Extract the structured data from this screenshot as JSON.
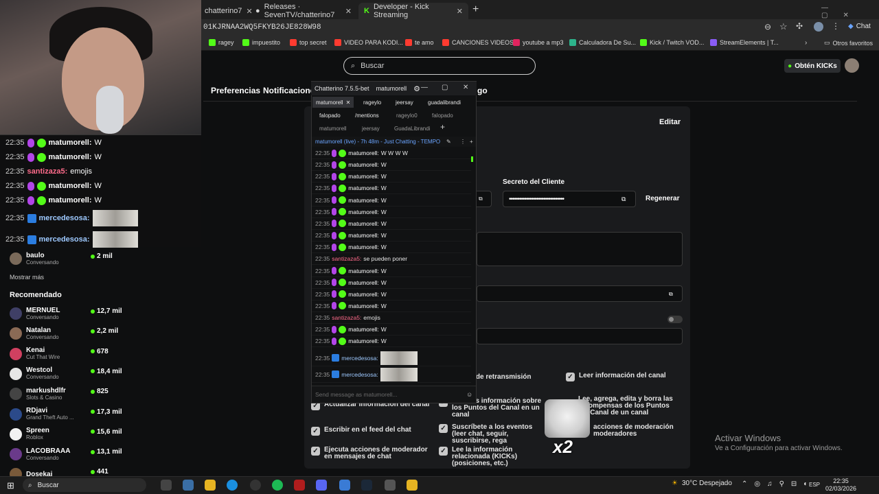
{
  "browser": {
    "tabs": [
      {
        "label": "chatterino7",
        "icon": "tab-icon"
      },
      {
        "label": "Releases · SevenTV/chatterino7",
        "icon": "github-icon"
      },
      {
        "label": "Developer - Kick Streaming",
        "icon": "kick-icon"
      }
    ],
    "url": "01KJRNAA2WQ5FKYB26JE828W98",
    "chat_label": "Chat",
    "bookmarks": [
      {
        "label": "ragey",
        "color": "#53fc18"
      },
      {
        "label": "impuestito",
        "color": "#53fc18"
      },
      {
        "label": "top secret",
        "color": "#ff3b30"
      },
      {
        "label": "VIDEO PARA KODI...",
        "color": "#ff3b30"
      },
      {
        "label": "te amo",
        "color": "#ff3b30"
      },
      {
        "label": "CANCIONES VIDEOS",
        "color": "#ff3b30"
      },
      {
        "label": "youtube a mp3",
        "color": "#e0245e"
      },
      {
        "label": "Calculadora De Su...",
        "color": "#2db38b"
      },
      {
        "label": "Kick / Twitch VOD...",
        "color": "#53fc18"
      },
      {
        "label": "StreamElements | T...",
        "color": "#8a5cf6"
      }
    ],
    "other_bookmarks": "Otros favoritos"
  },
  "kick": {
    "search_placeholder": "Buscar",
    "kicks_button": "Obtén KICKs",
    "nav": [
      "Preferencias",
      "Notificaciones",
      "go"
    ],
    "edit_button": "Editar",
    "client_secret_label": "Secreto del Cliente",
    "client_secret_value": "••••••••••••••••••••••••••••••••",
    "regenerate_button": "Regenerar",
    "permissions": [
      {
        "label": "ve de retransmisión",
        "checked": false
      },
      {
        "label": "Leer información del canal",
        "checked": true
      },
      {
        "label": "Lee más información sobre los Puntos del Canal en un canal",
        "checked": false
      },
      {
        "label": "Lee, agrega, edita y borra las recompensas de los Puntos del Canal de un canal",
        "checked": false
      },
      {
        "label": "Actualizar información del canal",
        "checked": true
      },
      {
        "label": "Escribir en el feed del chat",
        "checked": true
      },
      {
        "label": "Suscríbete a los eventos (leer chat, seguir, suscribirse, rega",
        "checked": true
      },
      {
        "label": "acciones de moderación moderadores",
        "checked": false
      },
      {
        "label": "Ejecuta acciones de moderador en mensajes de chat",
        "checked": true
      },
      {
        "label": "Lee la información relacionada (KICKs) (posiciones, etc.)",
        "checked": true
      }
    ],
    "sidebar_channels_top": [
      {
        "name": "baulo",
        "sub": "Conversando",
        "viewers": "2 mil",
        "color": "#7a6a5a"
      }
    ],
    "show_more": "Mostrar más",
    "recommended_title": "Recomendado",
    "recommended": [
      {
        "name": "MERNUEL",
        "sub": "Conversando",
        "viewers": "12,7 mil",
        "color": "#3f3f66"
      },
      {
        "name": "Natalan",
        "sub": "Conversando",
        "viewers": "2,2 mil",
        "color": "#8a6a55"
      },
      {
        "name": "Kenai",
        "sub": "Cut That Wire",
        "viewers": "678",
        "color": "#d04060"
      },
      {
        "name": "Westcol",
        "sub": "Conversando",
        "viewers": "18,4 mil",
        "color": "#e6e6e6"
      },
      {
        "name": "markushdlfr",
        "sub": "Slots & Casino",
        "viewers": "825",
        "color": "#444444"
      },
      {
        "name": "RDjavi",
        "sub": "Grand Theft Auto ...",
        "viewers": "17,3 mil",
        "color": "#2b4a8a"
      },
      {
        "name": "Spreen",
        "sub": "Roblox",
        "viewers": "15,6 mil",
        "color": "#f2f2f2"
      },
      {
        "name": "LACOBRAAA",
        "sub": "Conversando",
        "viewers": "13,1 mil",
        "color": "#6a3a8a"
      },
      {
        "name": "Dosekai",
        "sub": "",
        "viewers": "441",
        "color": "#7a5a3a"
      }
    ]
  },
  "overlay_chat": [
    {
      "time": "22:35",
      "user": "matumorell",
      "msg": "W",
      "type": "sub"
    },
    {
      "time": "22:35",
      "user": "matumorell",
      "msg": "W",
      "type": "sub"
    },
    {
      "time": "22:35",
      "user": "santizaza5",
      "msg": "emojis",
      "type": "plain"
    },
    {
      "time": "22:35",
      "user": "matumorell",
      "msg": "W",
      "type": "sub"
    },
    {
      "time": "22:35",
      "user": "matumorell",
      "msg": "W",
      "type": "sub"
    },
    {
      "time": "22:35",
      "user": "mercedesosa",
      "msg": "",
      "type": "emote"
    },
    {
      "time": "22:35",
      "user": "mercedesosa",
      "msg": "",
      "type": "emote"
    }
  ],
  "chatterino": {
    "title": "Chatterino 7.5.5-bet",
    "channel": "matumorell",
    "tabs_row1": [
      "matumorell",
      "rageylo",
      "jeersay",
      "guadalibrandi"
    ],
    "tabs_row2": [
      "falopado",
      "/mentions",
      "rageylo0",
      "falopado"
    ],
    "tabs_row3": [
      "matumorell",
      "jeersay",
      "GuadaLibrandi"
    ],
    "live_status": "matumorell (live) - 7h 48m - Just Chatting - TEMPO",
    "input_placeholder": "Send message as matumorell...",
    "messages": [
      {
        "time": "22:35",
        "user": "matumorell",
        "msg": "W W W W",
        "type": "sub"
      },
      {
        "time": "22:35",
        "user": "matumorell",
        "msg": "W",
        "type": "sub"
      },
      {
        "time": "22:35",
        "user": "matumorell",
        "msg": "W",
        "type": "sub"
      },
      {
        "time": "22:35",
        "user": "matumorell",
        "msg": "W",
        "type": "sub"
      },
      {
        "time": "22:35",
        "user": "matumorell",
        "msg": "W",
        "type": "sub"
      },
      {
        "time": "22:35",
        "user": "matumorell",
        "msg": "W",
        "type": "sub"
      },
      {
        "time": "22:35",
        "user": "matumorell",
        "msg": "W",
        "type": "sub"
      },
      {
        "time": "22:35",
        "user": "matumorell",
        "msg": "W",
        "type": "sub"
      },
      {
        "time": "22:35",
        "user": "matumorell",
        "msg": "W",
        "type": "sub"
      },
      {
        "time": "22:35",
        "user": "santizaza5",
        "msg": "se pueden poner",
        "type": "plain"
      },
      {
        "time": "22:35",
        "user": "matumorell",
        "msg": "W",
        "type": "sub"
      },
      {
        "time": "22:35",
        "user": "matumorell",
        "msg": "W",
        "type": "sub"
      },
      {
        "time": "22:35",
        "user": "matumorell",
        "msg": "W",
        "type": "sub"
      },
      {
        "time": "22:35",
        "user": "matumorell",
        "msg": "W",
        "type": "sub"
      },
      {
        "time": "22:35",
        "user": "santizaza5",
        "msg": "emojis",
        "type": "plain"
      },
      {
        "time": "22:35",
        "user": "matumorell",
        "msg": "W",
        "type": "sub"
      },
      {
        "time": "22:35",
        "user": "matumorell",
        "msg": "W",
        "type": "sub"
      }
    ],
    "emote_messages": [
      {
        "time": "22:35",
        "user": "mercedesosa"
      },
      {
        "time": "22:35",
        "user": "mercedesosa"
      }
    ]
  },
  "overlay_emote_text": "x2",
  "windows": {
    "activate_title": "Activar Windows",
    "activate_sub": "Ve a Configuración para activar Windows.",
    "search": "Buscar",
    "weather": "30°C  Despejado",
    "lang": "ESP",
    "time": "22:35",
    "date": "02/03/2026"
  }
}
